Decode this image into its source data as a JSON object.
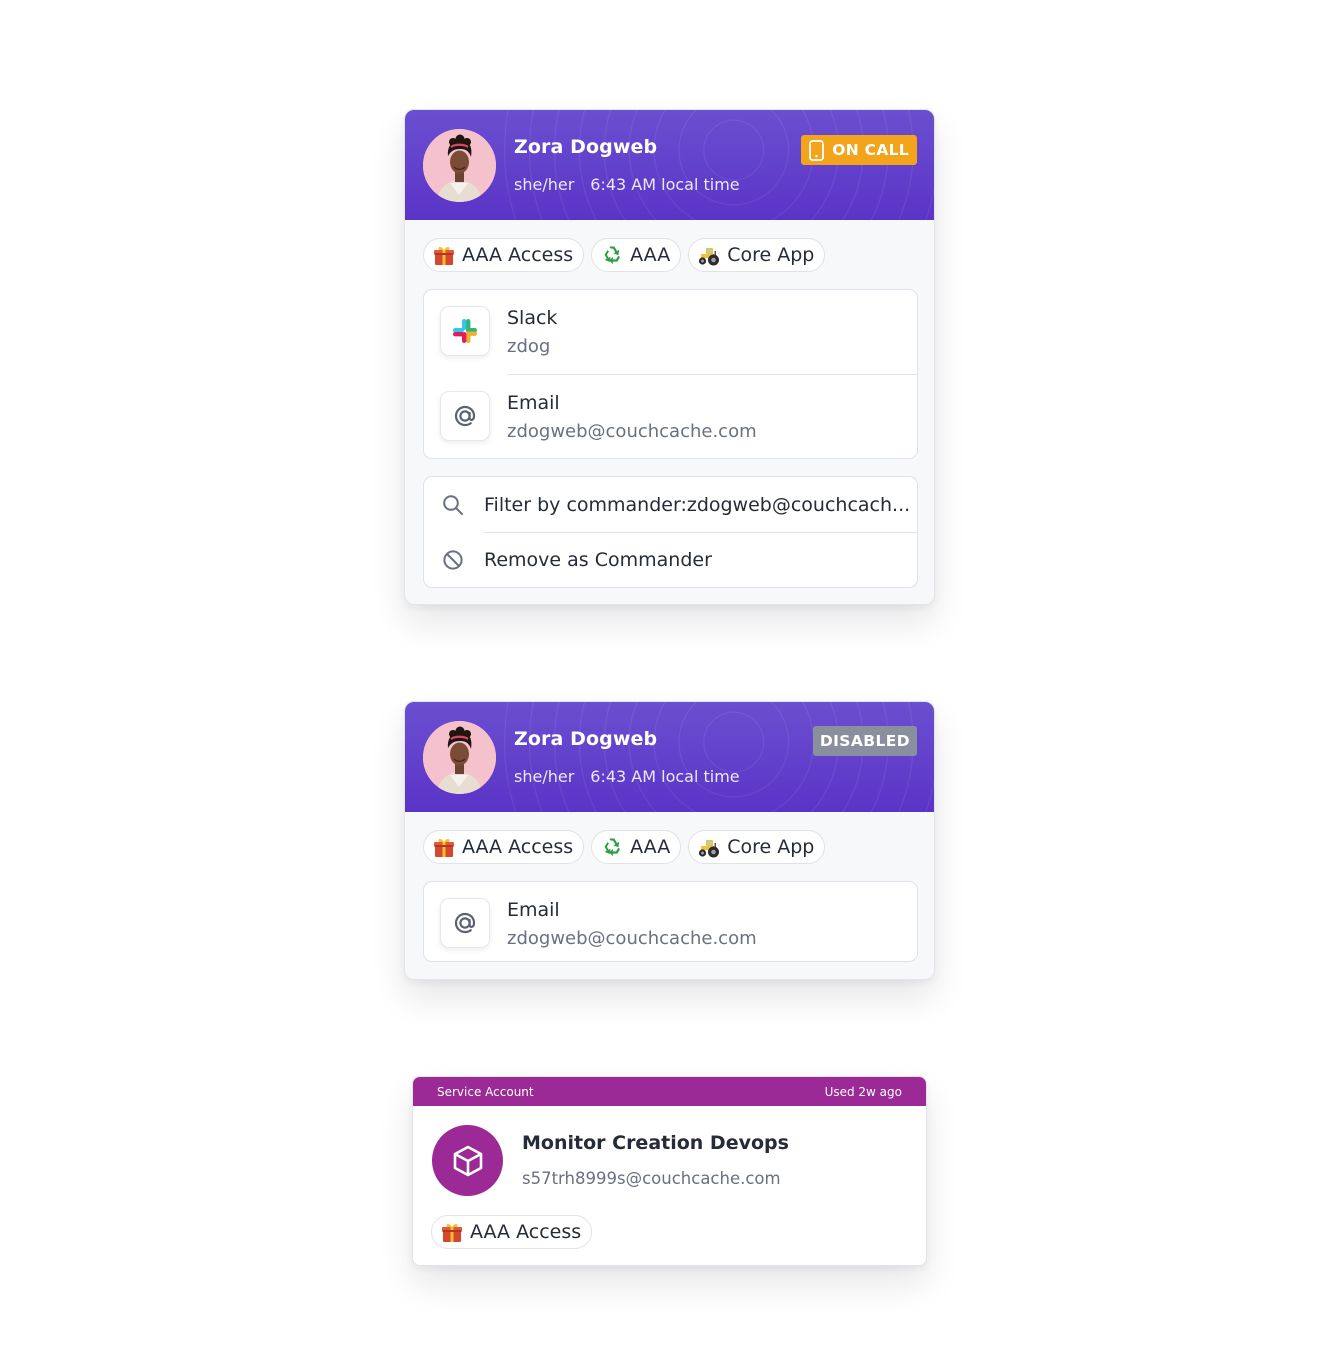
{
  "cards": [
    {
      "name": "Zora Dogweb",
      "pronouns": "she/her",
      "local_time": "6:43 AM local time",
      "status": "ON CALL",
      "tags": [
        {
          "icon": "gift-icon",
          "label": "AAA Access"
        },
        {
          "icon": "recycle-icon",
          "label": "AAA"
        },
        {
          "icon": "tractor-icon",
          "label": "Core App"
        }
      ],
      "contacts": [
        {
          "icon": "slack-icon",
          "label": "Slack",
          "value": "zdog"
        },
        {
          "icon": "at-icon",
          "label": "Email",
          "value": "zdogweb@couchcache.com"
        }
      ],
      "actions": [
        {
          "icon": "search-icon",
          "label": "Filter by commander:zdogweb@couchcach..."
        },
        {
          "icon": "block-icon",
          "label": "Remove as Commander"
        }
      ]
    },
    {
      "name": "Zora Dogweb",
      "pronouns": "she/her",
      "local_time": "6:43 AM local time",
      "status": "DISABLED",
      "tags": [
        {
          "icon": "gift-icon",
          "label": "AAA Access"
        },
        {
          "icon": "recycle-icon",
          "label": "AAA"
        },
        {
          "icon": "tractor-icon",
          "label": "Core App"
        }
      ],
      "contacts": [
        {
          "icon": "at-icon",
          "label": "Email",
          "value": "zdogweb@couchcache.com"
        }
      ]
    }
  ],
  "service_account": {
    "type_label": "Service Account",
    "last_used": "Used 2w ago",
    "name": "Monitor Creation Devops",
    "email": "s57trh8999s@couchcache.com",
    "tags": [
      {
        "icon": "gift-icon",
        "label": "AAA Access"
      }
    ]
  },
  "colors": {
    "header_purple": "#5b34c7",
    "on_call": "#f3a41a",
    "disabled": "#8a8f9d",
    "service_magenta": "#9c2a96"
  }
}
